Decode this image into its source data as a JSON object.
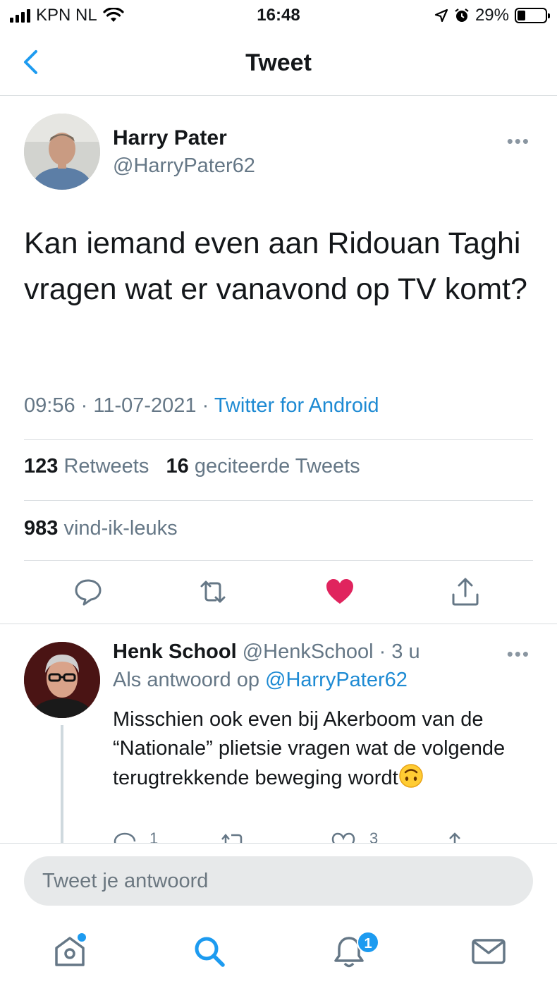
{
  "status_bar": {
    "carrier": "KPN NL",
    "time": "16:48",
    "battery_percent": "29%",
    "battery_level": 0.29
  },
  "nav": {
    "title": "Tweet"
  },
  "tweet": {
    "author_name": "Harry Pater",
    "author_handle": "@HarryPater62",
    "more": "•••",
    "text": "Kan iemand even aan Ridouan Taghi vragen wat er vanavond op TV komt?",
    "time": "09:56",
    "date": "11-07-2021",
    "separator": " · ",
    "source": "Twitter for Android",
    "retweets_count": "123",
    "retweets_label": "Retweets",
    "quotes_count": "16",
    "quotes_label": "geciteerde Tweets",
    "likes_count": "983",
    "likes_label": "vind-ik-leuks",
    "liked": true
  },
  "reply": {
    "author_name": "Henk School",
    "author_handle": "@HenkSchool",
    "age": " · 3 u",
    "more": "•••",
    "reply_to_label": "Als antwoord op ",
    "reply_to_mention": "@HarryPater62",
    "text": "Misschien ook even bij Akerboom van de “Nationale” plietsie vragen wat de volgende terugtrekkende beweging wordt",
    "reply_count": "1",
    "like_count": "3"
  },
  "compose": {
    "placeholder": "Tweet je antwoord"
  },
  "tabbar": {
    "notifications_badge": "1"
  },
  "colors": {
    "accent": "#1d9bf0",
    "like": "#e0245e",
    "secondary_text": "#657786"
  }
}
